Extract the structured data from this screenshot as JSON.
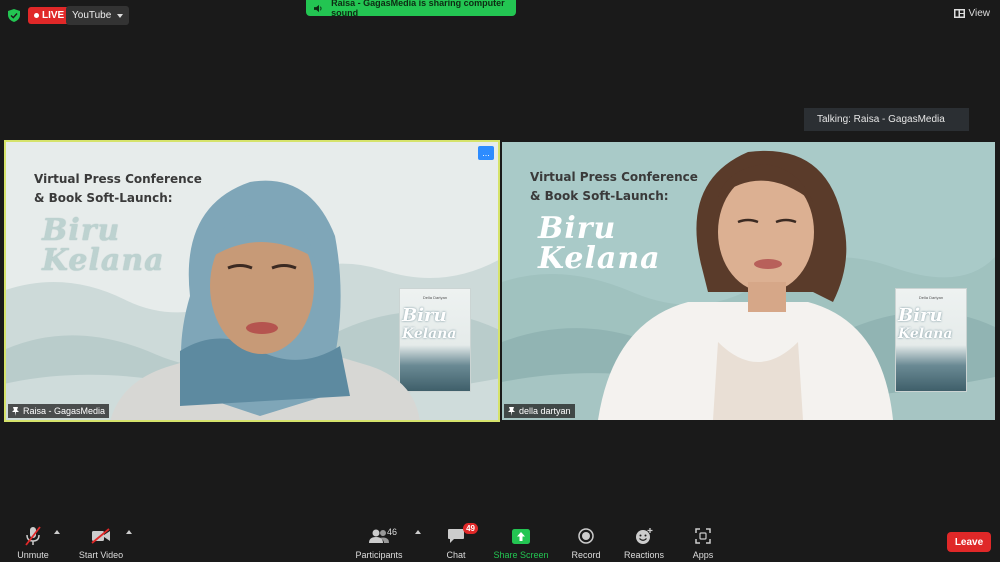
{
  "topbar": {
    "live_label": "LIVE",
    "stream_target": "YouTube",
    "sound_banner": "Raisa - GagasMedia is sharing computer sound",
    "view_label": "View"
  },
  "talking_label": "Talking: Raisa - GagasMedia",
  "tiles": [
    {
      "participant": "Raisa - GagasMedia",
      "conf_title_line1": "Virtual Press Conference",
      "conf_title_line2": "& Book Soft-Launch:",
      "book_title_line1": "Biru",
      "book_title_line2": "Kelana",
      "book_cover_author": "Della Dartyan",
      "active_speaker": true,
      "more_label": "..."
    },
    {
      "participant": "della dartyan",
      "conf_title_line1": "Virtual Press Conference",
      "conf_title_line2": "& Book Soft-Launch:",
      "book_title_line1": "Biru",
      "book_title_line2": "Kelana",
      "book_cover_author": "Della Dartyan",
      "active_speaker": false
    }
  ],
  "toolbar": {
    "unmute": "Unmute",
    "start_video": "Start Video",
    "participants": "Participants",
    "participants_count": "46",
    "chat": "Chat",
    "chat_badge": "49",
    "share_screen": "Share Screen",
    "record": "Record",
    "reactions": "Reactions",
    "apps": "Apps",
    "leave": "Leave"
  },
  "colors": {
    "background": "#1a1a1a",
    "live_red": "#e02828",
    "share_green": "#23c552",
    "active_border": "#d6e36b",
    "more_blue": "#2d8cff"
  },
  "icons": [
    "shield-icon",
    "speaker-icon",
    "view-icon",
    "mic-muted-icon",
    "video-off-icon",
    "participants-icon",
    "chat-icon",
    "share-screen-icon",
    "record-icon",
    "reactions-icon",
    "apps-icon",
    "pin-icon"
  ]
}
